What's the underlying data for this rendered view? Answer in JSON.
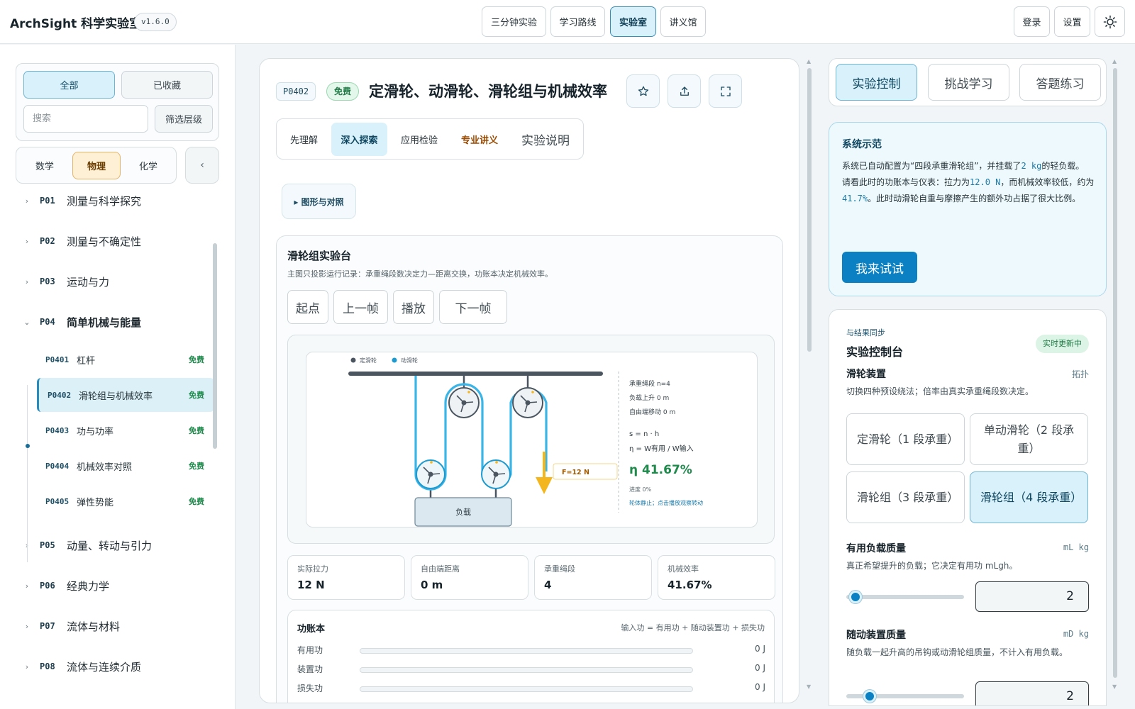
{
  "app": {
    "title": "ArchSight 科学实验室",
    "version": "v1.6.0"
  },
  "topnav": [
    {
      "label": "三分钟实验",
      "active": false
    },
    {
      "label": "学习路线",
      "active": false
    },
    {
      "label": "实验室",
      "active": true
    },
    {
      "label": "讲义馆",
      "active": false
    }
  ],
  "top_actions": {
    "login": "登录",
    "settings": "设置",
    "theme_icon": "sun-icon"
  },
  "sidebar": {
    "filters": {
      "all": "全部",
      "favorites": "已收藏",
      "search_placeholder": "搜索",
      "level_filter": "筛选层级"
    },
    "subjects": [
      {
        "label": "数学",
        "active": false
      },
      {
        "label": "物理",
        "active": true
      },
      {
        "label": "化学",
        "active": false
      }
    ],
    "collapse": "‹",
    "chapters": [
      {
        "code": "P01",
        "title": "测量与科学探究",
        "expanded": false
      },
      {
        "code": "P02",
        "title": "测量与不确定性",
        "expanded": false
      },
      {
        "code": "P03",
        "title": "运动与力",
        "expanded": false
      },
      {
        "code": "P04",
        "title": "简单机械与能量",
        "expanded": true
      },
      {
        "code": "P05",
        "title": "动量、转动与引力",
        "expanded": false
      },
      {
        "code": "P06",
        "title": "经典力学",
        "expanded": false
      },
      {
        "code": "P07",
        "title": "流体与材料",
        "expanded": false
      },
      {
        "code": "P08",
        "title": "流体与连续介质",
        "expanded": false
      }
    ],
    "lessons": [
      {
        "code": "P0401",
        "title": "杠杆",
        "badge": "免费",
        "active": false
      },
      {
        "code": "P0402",
        "title": "滑轮组与机械效率",
        "badge": "免费",
        "active": true
      },
      {
        "code": "P0403",
        "title": "功与功率",
        "badge": "免费",
        "active": false
      },
      {
        "code": "P0404",
        "title": "机械效率对照",
        "badge": "免费",
        "active": false
      },
      {
        "code": "P0405",
        "title": "弹性势能",
        "badge": "免费",
        "active": false
      }
    ]
  },
  "main": {
    "lesson_code": "P0402",
    "badge": "免费",
    "title": "定滑轮、动滑轮、滑轮组与机械效率",
    "icons": [
      "star-icon",
      "share-icon",
      "fullscreen-icon"
    ],
    "modes": [
      {
        "label": "先理解",
        "style": "normal"
      },
      {
        "label": "深入探索",
        "style": "active"
      },
      {
        "label": "应用检验",
        "style": "normal"
      },
      {
        "label": "专业讲义",
        "style": "lecture"
      },
      {
        "label": "实验说明",
        "style": "big"
      }
    ],
    "figure_toggle": "▸ 图形与对照",
    "bench": {
      "title": "滑轮组实验台",
      "desc": "主图只投影运行记录：承重绳段数决定力—距离交换，功账本决定机械效率。",
      "playback": [
        "起点",
        "上一帧",
        "播放",
        "下一帧"
      ],
      "diagram": {
        "legend": [
          "定滑轮",
          "动滑轮"
        ],
        "load_label": "负载",
        "force_label": "F=12 N",
        "readout": [
          "承重绳段 n=4",
          "负载上升 0 m",
          "自由端移动 0 m"
        ],
        "formulas": [
          "s = n · h",
          "η = W有用 / W输入"
        ],
        "efficiency": "η 41.67%",
        "progress": "进度 0%",
        "hint": "轮体静止；点击播放观察转动",
        "colors": {
          "fixed": "#4a5560",
          "movable": "#1d9bd1",
          "rope": "#3bb4e6",
          "force": "#f3b61f",
          "efficiency": "#1f8a4c"
        }
      },
      "metrics": [
        {
          "label": "实际拉力",
          "value": "12 N"
        },
        {
          "label": "自由端距离",
          "value": "0 m"
        },
        {
          "label": "承重绳段",
          "value": "4"
        },
        {
          "label": "机械效率",
          "value": "41.67%"
        }
      ],
      "ledger": {
        "title": "功账本",
        "formula": "输入功 = 有用功 + 随动装置功 + 损失功",
        "rows": [
          {
            "label": "有用功",
            "value": "0 J",
            "fraction": 0
          },
          {
            "label": "装置功",
            "value": "0 J",
            "fraction": 0
          },
          {
            "label": "损失功",
            "value": "0 J",
            "fraction": 0
          }
        ]
      }
    }
  },
  "right": {
    "tabs": [
      {
        "label": "实验控制",
        "active": true
      },
      {
        "label": "挑战学习",
        "active": false
      },
      {
        "label": "答题练习",
        "active": false
      }
    ],
    "demo": {
      "title": "系统示范",
      "p1_a": "系统已自动配置为“四段承重滑轮组”，并挂载了",
      "p1_b": "2 kg",
      "p1_c": "的轻负载。",
      "p2_a": "请看此时的功账本与仪表：拉力为",
      "p2_b": "12.0 N",
      "p2_c": "，而机械效率较低，约为",
      "p2_d": "41.7%",
      "p2_e": "。此时动滑轮自重与摩擦产生的额外功占据了很大比例。",
      "button": "我来试试"
    },
    "console": {
      "sync": "与结果同步",
      "title": "实验控制台",
      "live": "实时更新中",
      "pulley": {
        "title": "滑轮装置",
        "tag": "拓扑",
        "desc": "切换四种预设绕法；倍率由真实承重绳段数决定。",
        "options": [
          {
            "label": "定滑轮（1 段承重）",
            "active": false
          },
          {
            "label": "单动滑轮（2 段承重）",
            "active": false
          },
          {
            "label": "滑轮组（3 段承重）",
            "active": false
          },
          {
            "label": "滑轮组（4 段承重）",
            "active": true
          }
        ]
      },
      "load": {
        "title": "有用负载质量",
        "tag": "mL kg",
        "desc": "真正希望提升的负载；它决定有用功 mLgh。",
        "value": "2",
        "fraction": 0.08
      },
      "device": {
        "title": "随动装置质量",
        "tag": "mD kg",
        "desc": "随负载一起升高的吊钩或动滑轮组质量，不计入有用负载。",
        "value": "2",
        "fraction": 0.2
      }
    }
  }
}
